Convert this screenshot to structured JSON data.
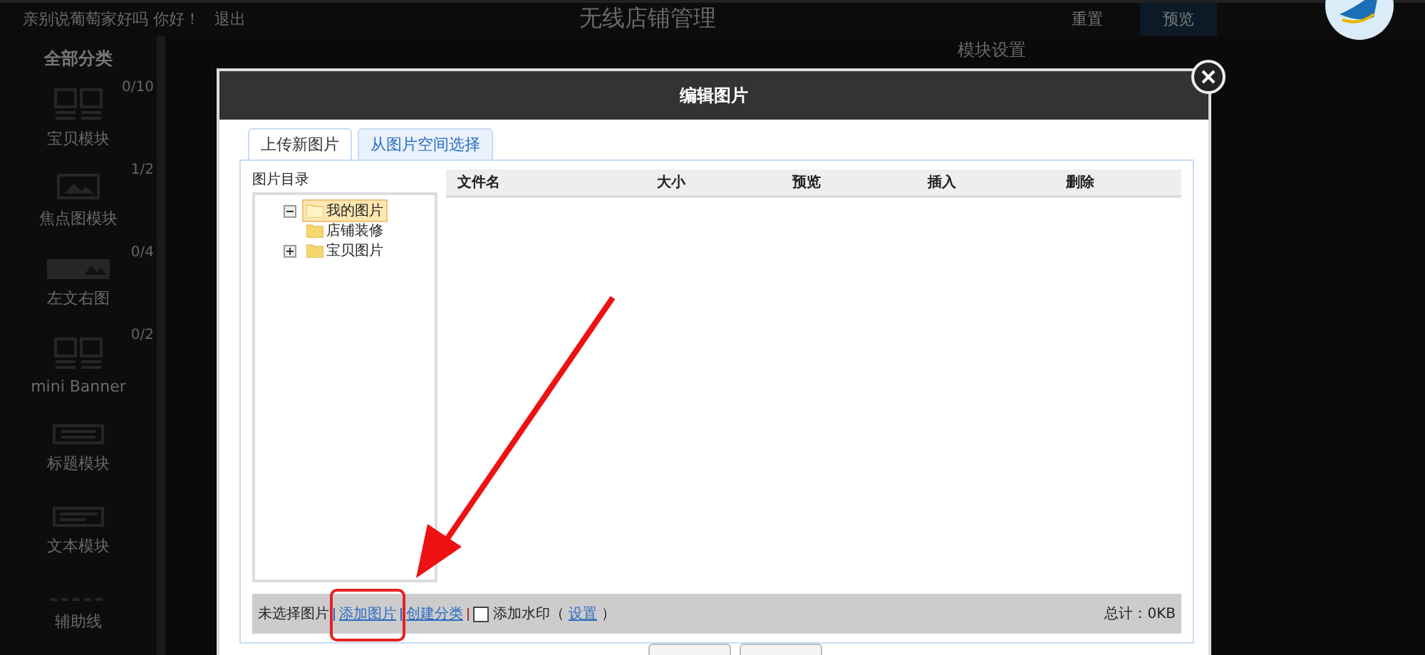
{
  "page": {
    "user_greeting": "亲别说葡萄家好吗 你好！",
    "logout": "退出",
    "title": "无线店铺管理",
    "buttons": [
      {
        "label": "重置",
        "kind": "plain"
      },
      {
        "label": "预览",
        "kind": "primary"
      }
    ],
    "sidebar": {
      "heading": "全部分类",
      "items": [
        {
          "label": "宝贝模块",
          "count": "0/10",
          "kind": "pair"
        },
        {
          "label": "焦点图模块",
          "count": "1/2",
          "kind": "wide"
        },
        {
          "label": "左文右图",
          "count": "0/4",
          "kind": "textimage"
        },
        {
          "label": "mini Banner",
          "count": "0/2",
          "kind": "pair"
        },
        {
          "label": "标题模块",
          "kind": "text"
        },
        {
          "label": "文本模块",
          "kind": "lines"
        },
        {
          "label": "辅助线",
          "kind": "dash"
        }
      ]
    },
    "panel_title": "模块设置"
  },
  "dialog": {
    "title": "编辑图片",
    "tabs": [
      {
        "label": "上传新图片",
        "selected": true
      },
      {
        "label": "从图片空间选择",
        "selected": false
      }
    ],
    "tree": {
      "heading": "图片目录",
      "items": [
        {
          "label": "我的图片",
          "expanded": true,
          "selected": true,
          "children": [
            {
              "label": "店铺装修",
              "selected": false
            },
            {
              "label": "宝贝图片",
              "expanded": false,
              "selected": false
            }
          ]
        }
      ]
    },
    "table": {
      "columns": [
        "文件名",
        "大小",
        "预览",
        "插入",
        "删除"
      ]
    },
    "footer": {
      "status": "未选择图片",
      "links": [
        "添加图片",
        "创建分类"
      ],
      "watermark": {
        "label": "添加水印（",
        "checked": false,
        "settings_link": "设置",
        "close": "）"
      },
      "total": "总计：0KB"
    }
  }
}
